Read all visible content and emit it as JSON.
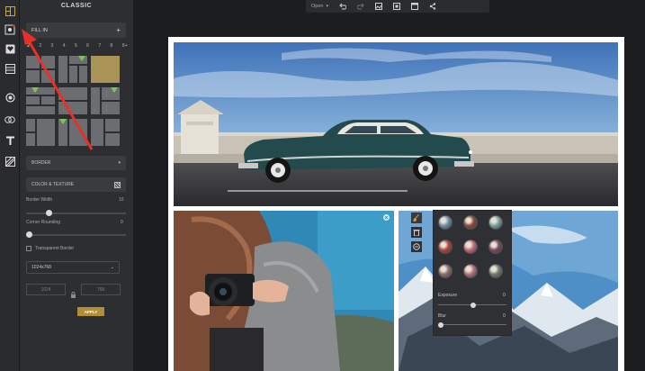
{
  "panel": {
    "title": "CLASSIC",
    "fill_in_label": "FILL IN",
    "fill_in_plus": "+",
    "counts": [
      "2",
      "2",
      "3",
      "4",
      "5",
      "6",
      "7",
      "8",
      "8+"
    ],
    "border_label": "BORDER",
    "border_chevron": "▾",
    "color_texture_label": "COLOR & TEXTURE",
    "border_width_label": "Border Width",
    "border_width_value": "10",
    "corner_rounding_label": "Corner Rounding",
    "corner_rounding_value": "0",
    "transparent_border_label": "Transparent Border",
    "size_select_value": "1024x768",
    "width_value": "1024",
    "height_value": "768",
    "apply_label": "APPLY"
  },
  "toolbar": {
    "open_label": "Open"
  },
  "adjust": {
    "exposure_label": "Exposure",
    "exposure_value": "0",
    "blur_label": "Blur",
    "blur_value": "0",
    "swatch_colors": [
      "#6f8fa8",
      "#8a4b3c",
      "#7aa0a0",
      "#b04444",
      "#c86a78",
      "#7b4a5f",
      "#8c6d6d",
      "#b0727a",
      "#6e7b6f"
    ]
  },
  "colors": {
    "accent_gold": "#b08f36",
    "flag_green": "#7ec653",
    "arrow_red": "#e8302a"
  },
  "icons": [
    "layout-icon",
    "collage-icon",
    "heart-icon",
    "grid-icon",
    "circle-icon",
    "sticker-icon",
    "text-icon",
    "texture-icon",
    "undo-icon",
    "redo-icon",
    "image-icon",
    "crop-icon",
    "frame-icon",
    "share-icon",
    "close-icon",
    "brush-icon",
    "delete-icon"
  ]
}
